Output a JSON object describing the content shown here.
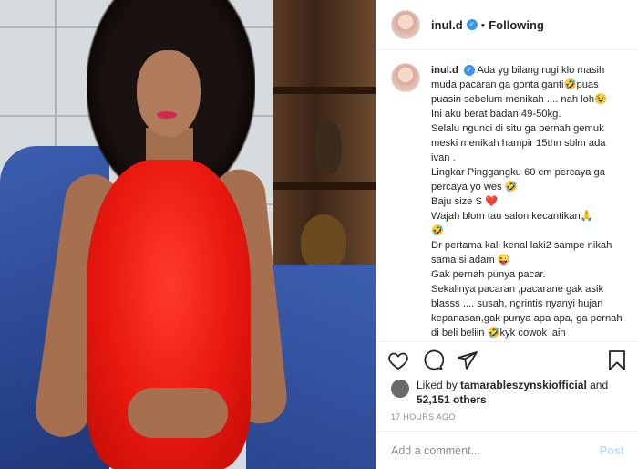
{
  "header": {
    "username": "inul.d",
    "separator": "•",
    "follow_status": "Following"
  },
  "caption": {
    "username": "inul.d",
    "lines": [
      "Ada yg bilang rugi klo masih muda pacaran ga gonta ganti🤣puas puasin sebelum menikah .... nah loh😉",
      "Ini aku berat badan 49-50kg.",
      "Selalu ngunci di situ ga pernah gemuk meski menikah hampir 15thn sblm ada ivan .",
      "Lingkar Pinggangku 60 cm percaya ga percaya yo wes 🤣",
      "Baju size S ❤️",
      "Wajah blom tau salon kecantikan🙏",
      "🤣",
      "Dr pertama kali kenal laki2 sampe nikah sama si adam 😜",
      "Gak pernah punya pacar.",
      "Sekalinya pacaran ,pacarane gak asik blasss .... susah, ngrintis nyanyi hujan kepanasan,gak punya apa apa, ga pernah di beli beliin 🤣kyk cowok lain"
    ]
  },
  "likes": {
    "prefix": "Liked by",
    "liker": "tamarableszynskiofficial",
    "and": "and",
    "count": "52,151 others"
  },
  "time_ago": "17 HOURS AGO",
  "comment": {
    "placeholder": "Add a comment...",
    "post_label": "Post"
  },
  "colors": {
    "verified": "#3897f0",
    "post_disabled": "#b2dffc",
    "dress": "#e8180f"
  },
  "icons": {
    "like": "heart-icon",
    "comment": "comment-icon",
    "share": "share-icon",
    "save": "bookmark-icon",
    "verified": "verified-badge-icon"
  }
}
